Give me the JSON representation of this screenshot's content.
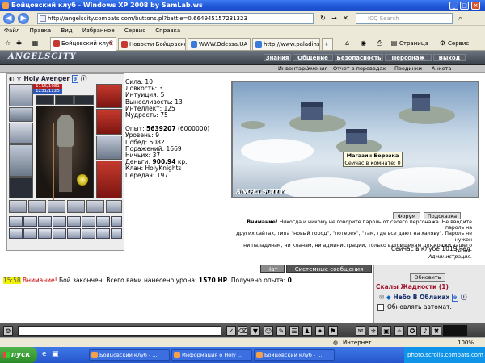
{
  "window": {
    "title": "Бойцовский клуб - Windows XP 2008 by SamLab.ws"
  },
  "address": {
    "url": "http://angelscity.combats.com/buttons.pl?battle=0.664945157231323",
    "search_placeholder": "ICQ Search"
  },
  "menu": [
    "Файл",
    "Правка",
    "Вид",
    "Избранное",
    "Сервис",
    "Справка"
  ],
  "tabs": [
    {
      "label": "Бойцовский клуб",
      "active": true
    },
    {
      "label": "Новости Бойцовског...",
      "active": false
    },
    {
      "label": "WWW.Odessa.UA - ...",
      "active": false
    },
    {
      "label": "http://www.paladins....",
      "active": false
    }
  ],
  "ie_toolbar": {
    "page": "Страница",
    "tools": "Сервис"
  },
  "game": {
    "logo": "ANGELSCITY",
    "topnav": [
      "Знания",
      "Общение",
      "Безопасность",
      "Персонаж",
      "Выход"
    ],
    "subnav": [
      "Инвентарь",
      "Умения",
      "Отчет о переводах",
      "Поединки",
      "Анкета"
    ]
  },
  "character": {
    "name": "Holy Avenger",
    "level": "9",
    "hp": "1116/1081",
    "mp": "1231/1225",
    "stats": [
      {
        "label": "Сила:",
        "value": "10"
      },
      {
        "label": "Ловкость:",
        "value": "3"
      },
      {
        "label": "Интуиция:",
        "value": "5"
      },
      {
        "label": "Выносливость:",
        "value": "13"
      },
      {
        "label": "Интеллект:",
        "value": "125"
      },
      {
        "label": "Мудрость:",
        "value": "75"
      }
    ],
    "exp_label": "Опыт:",
    "exp_value": "5639207",
    "exp_next": "(6000000)",
    "info": [
      {
        "label": "Уровень:",
        "value": "9"
      },
      {
        "label": "Побед:",
        "value": "5082"
      },
      {
        "label": "Поражений:",
        "value": "1669"
      },
      {
        "label": "Ничьих:",
        "value": "37"
      }
    ],
    "money_label": "Деньги:",
    "money_value": "900.94",
    "money_unit": "кр.",
    "clan_label": "Клан:",
    "clan_value": "HolyKnights",
    "transfers_label": "Передач:",
    "transfers_value": "197"
  },
  "scene": {
    "label": "ANGELSCITY",
    "tooltip_line1": "Магазин Березка",
    "tooltip_line2": "Сейчас в комнате: 0"
  },
  "scene_buttons": {
    "forum": "Форум",
    "help": "Подсказка"
  },
  "warning": {
    "title": "Внимание!",
    "text1": " Никогда и никому не говорите пароль от своего персонажа. Не вводите пароль на",
    "text2": "других сайтах, типа \"новый город\", \"лотерея\", \"там, где все дают на халяву\". Пароль не нужен",
    "text3": "ни паладинам, ни кланам, ни администрации,",
    "link": "только взломщикам",
    "text4": " для кражи вашего героя.",
    "sign": "Администрация."
  },
  "online": "Сейчас в клубе 1019 чел.",
  "chat": {
    "tab_chat": "Чат",
    "tab_system": "Системные сообщения",
    "time": "15:58",
    "warn_word": "Внимание!",
    "msg1": " Бой закончен. Всего вами нанесено урона: ",
    "damage": "1570 HP",
    "msg2": ". Получено опыта: ",
    "exp": "0",
    "msg3": "."
  },
  "right_panel": {
    "refresh": "Обновить",
    "location": "Скалы Жадности (1)",
    "player": "Небо В Облаках",
    "player_level": "9",
    "auto_refresh": "Обновлять автомат."
  },
  "statusbar": {
    "zone": "Интернет",
    "zoom": "100%"
  },
  "taskbar": {
    "start": "пуск",
    "items": [
      "Бойцовский клуб - ...",
      "Информация о Holy ...",
      "Бойцовский клуб - ..."
    ],
    "watermark": "photo.scrolls.combats.com"
  }
}
